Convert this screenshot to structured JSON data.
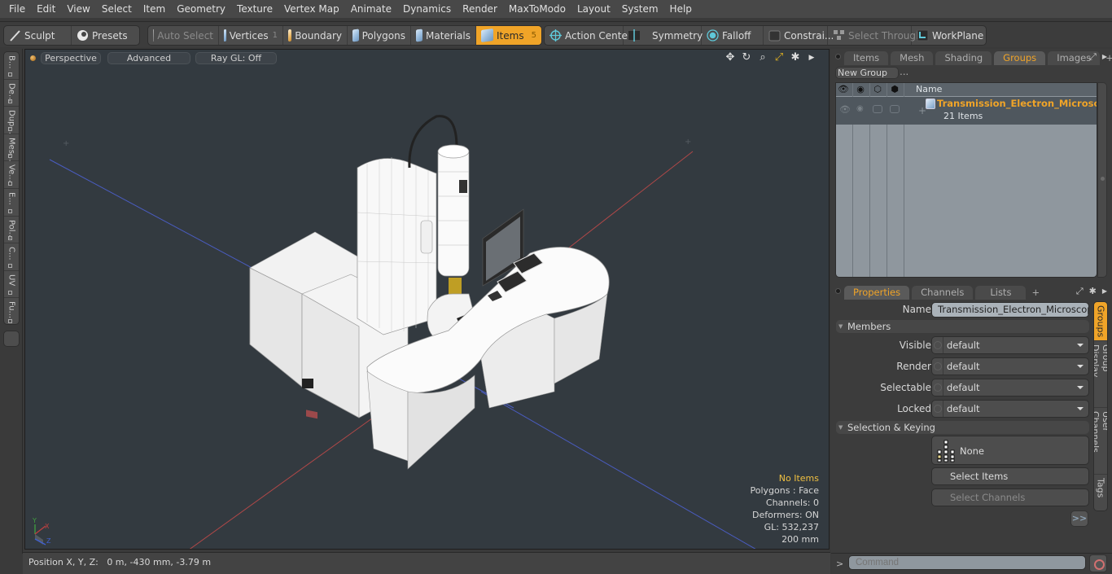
{
  "menu": [
    "File",
    "Edit",
    "View",
    "Select",
    "Item",
    "Geometry",
    "Texture",
    "Vertex Map",
    "Animate",
    "Dynamics",
    "Render",
    "MaxToModo",
    "Layout",
    "System",
    "Help"
  ],
  "toolbar": {
    "sculpt": "Sculpt",
    "presets": "Presets",
    "auto_select": "Auto Select",
    "vertices": "Vertices",
    "vertices_count": "1",
    "boundary": "Boundary",
    "polygons": "Polygons",
    "materials": "Materials",
    "items": "Items",
    "items_count": "5",
    "action_center": "Action Center",
    "symmetry": "Symmetry",
    "falloff": "Falloff",
    "constraints": "Constrai...",
    "select_through": "Select Through",
    "workplane": "WorkPlane",
    "accent_color": "#f0a428"
  },
  "left_tabs": [
    "B...",
    "De...",
    "Dup...",
    "Mes...",
    "Ve...",
    "E...",
    "Pol...",
    "C...",
    "UV",
    "Fu..."
  ],
  "viewport": {
    "view_mode": "Perspective",
    "shading": "Advanced",
    "raygl": "Ray GL: Off",
    "tools": [
      "move-icon",
      "rotate-icon",
      "zoom-icon",
      "maximize-icon",
      "settings-icon",
      "more-icon"
    ],
    "info": {
      "selection": "No Items",
      "polygons": "Polygons : Face",
      "channels": "Channels: 0",
      "deformers": "Deformers: ON",
      "gl": "GL: 532,237",
      "scale": "200 mm"
    },
    "axis": {
      "x_color": "#c04040",
      "y_color": "#40a040",
      "z_color": "#4060d0"
    }
  },
  "status": {
    "position_label": "Position X, Y, Z:",
    "position_value": "0 m, -430 mm, -3.79 m"
  },
  "top_panel": {
    "tabs": [
      "Items",
      "Mesh ...",
      "Shading",
      "Groups",
      "Images"
    ],
    "active_tab": "Groups",
    "new_group": "New Group",
    "columns": {
      "name": "Name"
    },
    "groups": [
      {
        "name": "Transmission_Electron_Microsc ...",
        "count": "21 Items"
      }
    ]
  },
  "bottom_panel": {
    "tabs": [
      "Properties",
      "Channels",
      "Lists"
    ],
    "active_tab": "Properties",
    "name_label": "Name",
    "name_value": "Transmission_Electron_Microscope_Wi",
    "members_label": "Members",
    "fields": [
      {
        "label": "Visible",
        "value": "default"
      },
      {
        "label": "Render",
        "value": "default"
      },
      {
        "label": "Selectable",
        "value": "default"
      },
      {
        "label": "Locked",
        "value": "default"
      }
    ],
    "selection_label": "Selection & Keying",
    "none_label": "None",
    "select_items": "Select Items",
    "select_channels": "Select Channels",
    "more": ">>",
    "side_tabs": [
      "Groups",
      "Group Display",
      "User Channels",
      "Tags"
    ]
  },
  "command": {
    "prompt": ">",
    "placeholder": "Command"
  }
}
